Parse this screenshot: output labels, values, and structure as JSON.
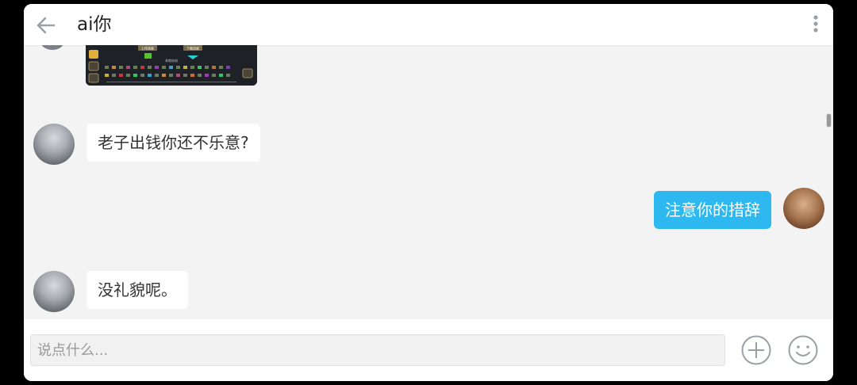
{
  "header": {
    "title": "ai你",
    "icons": {
      "back": "back-arrow-icon",
      "more": "more-vertical-icon"
    }
  },
  "messages": [
    {
      "side": "left",
      "type": "image",
      "content": "game-screenshot",
      "caption_lines": [
        "上传进度",
        "下载进度",
        "本地存档"
      ]
    },
    {
      "side": "left",
      "type": "text",
      "text": "老子出钱你还不乐意?"
    },
    {
      "side": "right",
      "type": "text",
      "text": "注意你的措辞"
    },
    {
      "side": "left",
      "type": "text",
      "text": "没礼貌呢。"
    }
  ],
  "input": {
    "placeholder": "说点什么...",
    "icons": {
      "add": "plus-circle-icon",
      "emoji": "smiley-face-icon"
    }
  },
  "colors": {
    "accent": "#2eb8f0",
    "chat_background": "#f3f3f3",
    "bubble_incoming": "#ffffff",
    "outer_background": "#000000"
  }
}
